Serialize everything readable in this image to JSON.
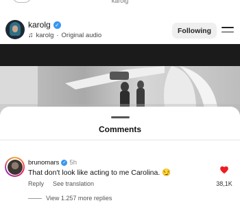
{
  "top": {
    "title": "karolg"
  },
  "header": {
    "username": "karolg",
    "audio_user": "karolg",
    "separator": "·",
    "audio_label": "Original audio",
    "follow_label": "Following"
  },
  "comments": {
    "title": "Comments",
    "items": [
      {
        "user": "brunomars",
        "time": "5h",
        "text": "That don't look like acting to me Carolina. 😏",
        "reply_label": "Reply",
        "translation_label": "See translation",
        "likes": "38,1K",
        "liked": true,
        "view_replies": "View 1.257 more replies"
      }
    ]
  },
  "colors": {
    "verified": "#3897f0",
    "heart": "#ed1c24"
  }
}
